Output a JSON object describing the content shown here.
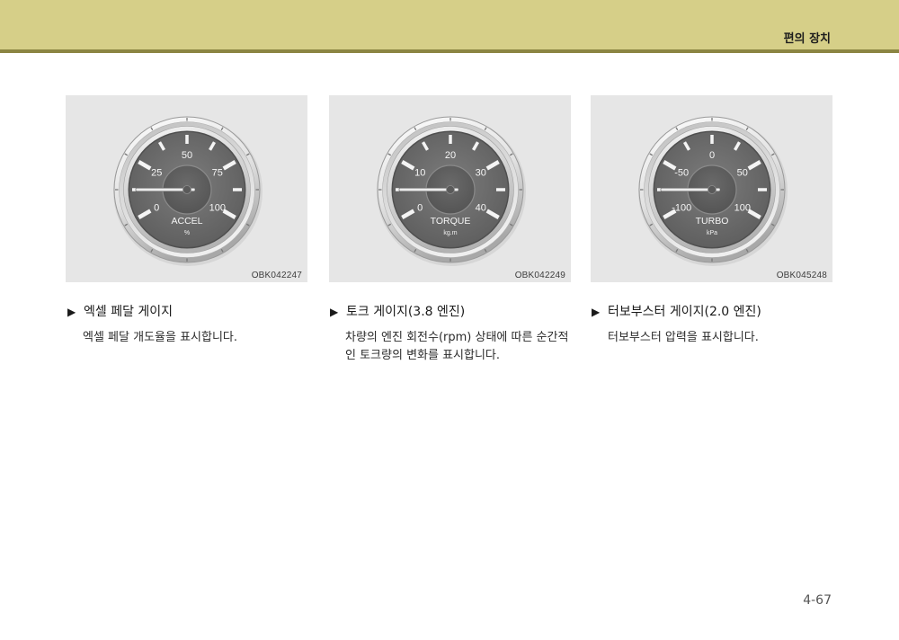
{
  "header": {
    "section_title": "편의 장치"
  },
  "heading_marker": "▶",
  "items": [
    {
      "heading": "엑셀 페달 게이지",
      "description_lines": [
        "엑셀 페달 개도율을 표시합니다."
      ],
      "figure": {
        "code": "OBK042247",
        "gauge": {
          "name": "ACCEL",
          "unit": "%",
          "scale": {
            "min": 0,
            "max": 100
          },
          "tick_labels": [
            "0",
            "25",
            "50",
            "75",
            "100"
          ],
          "needle_value": 12.5
        }
      }
    },
    {
      "heading": "토크 게이지(3.8 엔진)",
      "description_lines": [
        "차량의 엔진 회전수(rpm) 상태에 따른 순간적",
        "인 토크량의 변화를 표시합니다."
      ],
      "figure": {
        "code": "OBK042249",
        "gauge": {
          "name": "TORQUE",
          "unit": "kg.m",
          "scale": {
            "min": 0,
            "max": 40
          },
          "tick_labels": [
            "0",
            "10",
            "20",
            "30",
            "40"
          ],
          "needle_value": 5
        }
      }
    },
    {
      "heading": "터보부스터 게이지(2.0 엔진)",
      "description_lines": [
        "터보부스터 압력을 표시합니다."
      ],
      "figure": {
        "code": "OBK045248",
        "gauge": {
          "name": "TURBO",
          "unit": "kPa",
          "scale": {
            "min": -100,
            "max": 100
          },
          "tick_labels": [
            "-100",
            "-50",
            "0",
            "50",
            "100"
          ],
          "needle_value": -75
        }
      }
    }
  ],
  "footer": {
    "page_number": "4-67"
  },
  "colors": {
    "header_band": "#d6cf88",
    "header_rule": "#8b8542",
    "figure_background": "#e6e6e6",
    "gauge_face": "#6c6c6c"
  }
}
